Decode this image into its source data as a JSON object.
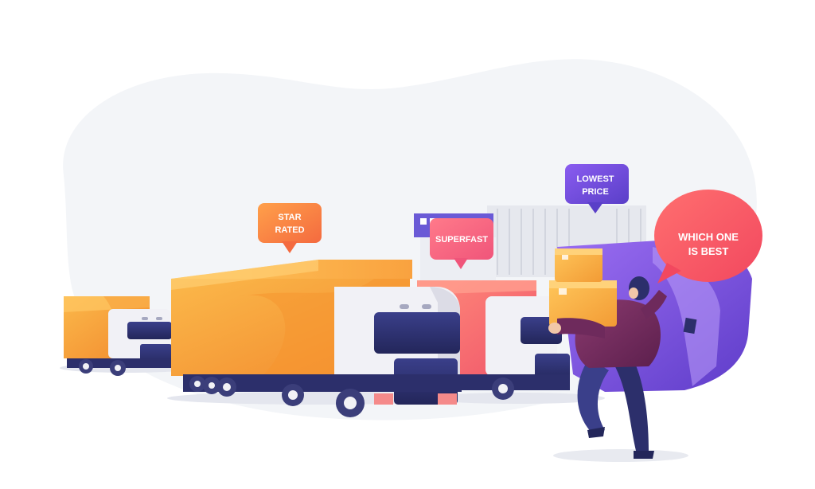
{
  "scene": {
    "description_colors": {
      "background_blob": "#f3f5f8",
      "truck_orange": "#f7a93a",
      "truck_pink": "#f56b6b",
      "cab_white": "#f2f2f6",
      "navy": "#2c2f6b",
      "purple": "#7c4fd0"
    }
  },
  "labels": {
    "star_rated_line1": "STAR",
    "star_rated_line2": "RATED",
    "superfast": "SUPERFAST",
    "lowest_price_line1": "LOWEST",
    "lowest_price_line2": "PRICE",
    "which_one_line1": "WHICH ONE",
    "which_one_line2": "IS BEST"
  },
  "icons": {
    "box": "package-icon"
  }
}
